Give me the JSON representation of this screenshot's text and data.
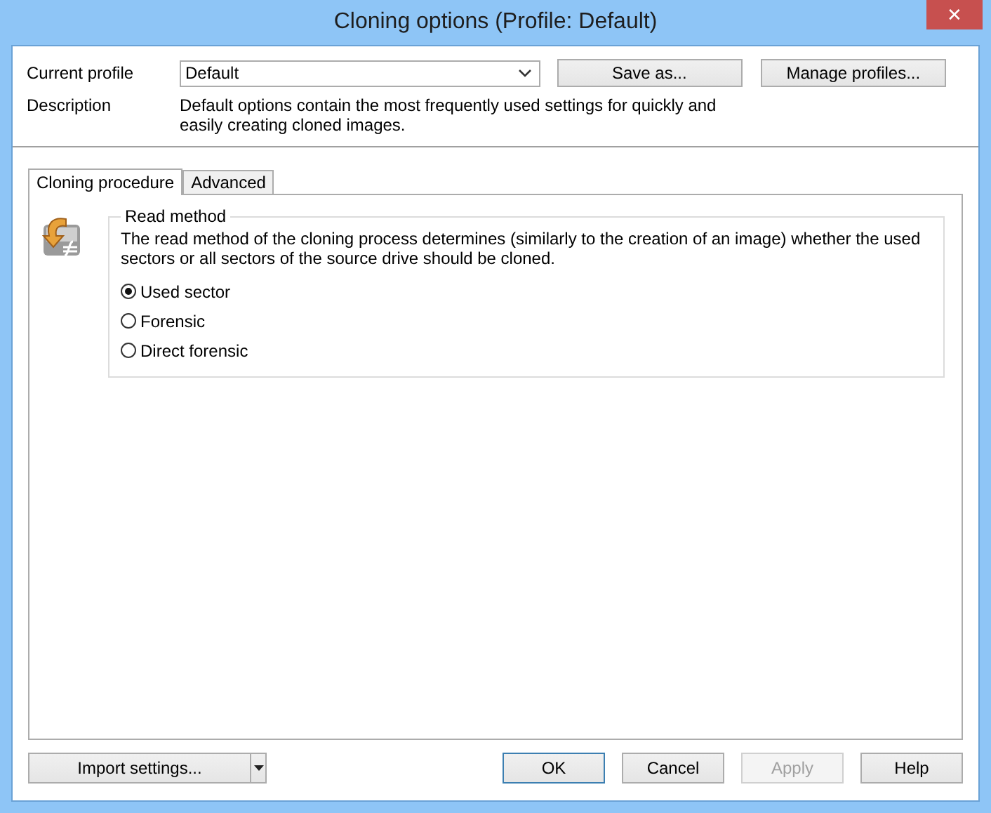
{
  "window": {
    "title": "Cloning options (Profile: Default)",
    "close": "✕"
  },
  "profile": {
    "label": "Current profile",
    "value": "Default",
    "buttons": [
      "Save as...",
      "Manage profiles..."
    ]
  },
  "description": {
    "label": "Description",
    "text": "Default options contain the most frequently used settings for quickly and easily creating cloned images."
  },
  "tabs": [
    {
      "label": "Cloning procedure",
      "selected": true
    },
    {
      "label": "Advanced",
      "selected": false
    }
  ],
  "read_method": {
    "title": "Read method",
    "text": "The read method of the cloning process determines (similarly to the creation of an image) whether the used sectors or all sectors of the source drive should be cloned.",
    "options": [
      {
        "label": "Used sector",
        "selected": true
      },
      {
        "label": "Forensic",
        "selected": false
      },
      {
        "label": "Direct forensic",
        "selected": false
      }
    ]
  },
  "footer": {
    "import": "Import settings...",
    "buttons": [
      {
        "label": "OK",
        "default": true,
        "disabled": false
      },
      {
        "label": "Cancel",
        "default": false,
        "disabled": false
      },
      {
        "label": "Apply",
        "default": false,
        "disabled": true
      },
      {
        "label": "Help",
        "default": false,
        "disabled": false
      }
    ]
  }
}
